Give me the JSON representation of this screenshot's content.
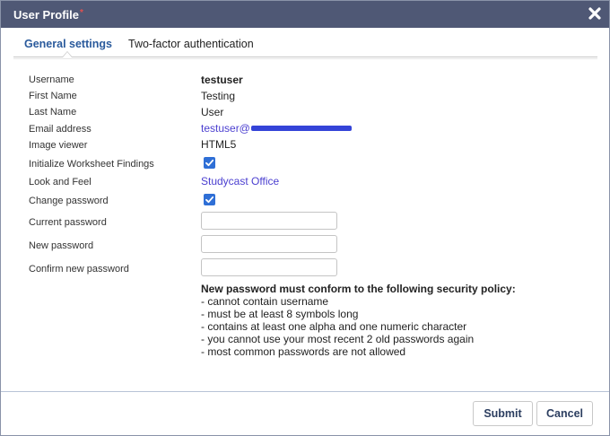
{
  "dialog": {
    "title": "User Profile",
    "title_marker": "*",
    "close_icon": "close-x-icon"
  },
  "tabs": [
    {
      "label": "General settings",
      "active": true
    },
    {
      "label": "Two-factor authentication",
      "active": false
    }
  ],
  "fields": {
    "username": {
      "label": "Username",
      "value": "testuser"
    },
    "first_name": {
      "label": "First Name",
      "value": "Testing"
    },
    "last_name": {
      "label": "Last Name",
      "value": "User"
    },
    "email": {
      "label": "Email address",
      "value_prefix": "testuser@"
    },
    "image_viewer": {
      "label": "Image viewer",
      "value": "HTML5"
    },
    "init_findings": {
      "label": "Initialize Worksheet Findings",
      "checked": true
    },
    "look_and_feel": {
      "label": "Look and Feel",
      "value": "Studycast Office"
    },
    "change_password": {
      "label": "Change password",
      "checked": true
    },
    "current_password": {
      "label": "Current password",
      "value": ""
    },
    "new_password": {
      "label": "New password",
      "value": ""
    },
    "confirm_password": {
      "label": "Confirm new password",
      "value": ""
    }
  },
  "policy": {
    "heading": "New password must conform to the following security policy:",
    "rules": [
      "- cannot contain username",
      "- must be at least 8 symbols long",
      "- contains at least one alpha and one numeric character",
      "- you cannot use your most recent 2 old passwords again",
      "- most common passwords are not allowed"
    ]
  },
  "buttons": {
    "submit": "Submit",
    "cancel": "Cancel"
  },
  "colors": {
    "titlebar": "#4f5875",
    "active_tab": "#2a5a9c",
    "link": "#4b3fd0",
    "checkbox": "#2f6fd6",
    "button_text": "#2c3e60"
  }
}
